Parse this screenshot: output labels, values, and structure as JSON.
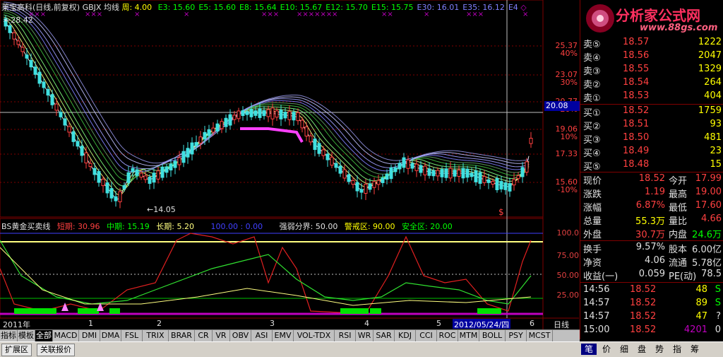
{
  "header": {
    "stock_name": "莱宝高科(日线,前复权)",
    "indicator": "GBJX 均线",
    "cycle": "周: 4.00",
    "ma": [
      {
        "label": "E3: 15.60",
        "color": "#00ff00"
      },
      {
        "label": "E5: 15.60",
        "color": "#00ff00"
      },
      {
        "label": "E8: 15.64",
        "color": "#00ff00"
      },
      {
        "label": "E10: 15.67",
        "color": "#00ff00"
      },
      {
        "label": "E12: 15.70",
        "color": "#00ff00"
      },
      {
        "label": "E15: 15.75",
        "color": "#00ff00"
      },
      {
        "label": "E30: 16.01",
        "color": "#8080ff"
      },
      {
        "label": "E35: 16.12",
        "color": "#8080ff"
      },
      {
        "label": "E4",
        "color": "#8080ff"
      }
    ],
    "marker": "◇"
  },
  "main_chart": {
    "y_ticks": [
      "25.37",
      "23.07",
      "20.77",
      "19.06",
      "17.33",
      "15.60"
    ],
    "y_pcts": [
      "40%",
      "30%",
      "20%",
      "10%",
      "",
      "-10%"
    ],
    "crosshair_value": "20.08",
    "high_label": "28.42",
    "low_label": "14.05",
    "signal_marks": [
      "×××",
      "×××",
      "×",
      "×",
      "×××",
      "×",
      "××××××",
      "××",
      "×",
      "×××",
      "×"
    ]
  },
  "indicator_panel": {
    "title": "BS黄金买卖线",
    "short_label": "短期: 30.96",
    "mid_label": "中期: 15.19",
    "long_label": "长期: 5.20",
    "extra_label": "100.00 : 0.00",
    "strength_label": "强弱分界: 50.00",
    "warn_label": "警戒区: 90.00",
    "safe_label": "安全区: 20.00",
    "y_ticks": [
      "100.0",
      "75.00",
      "50.00",
      "25.00"
    ]
  },
  "x_axis": {
    "labels": [
      "2011年",
      "1",
      "2",
      "3",
      "4",
      "5",
      "6"
    ],
    "cursor_date": "2012/05/24/四",
    "period": "日线"
  },
  "indicator_tabs": [
    "指标",
    "模板",
    "全部",
    "MACD",
    "DMI",
    "DMA",
    "FSL",
    "TRIX",
    "BRAR",
    "CR",
    "VR",
    "OBV",
    "ASI",
    "EMV",
    "VOL-TDX",
    "RSI",
    "WR",
    "SAR",
    "KDJ",
    "CCI",
    "ROC",
    "MTM",
    "BOLL",
    "PSY",
    "MCST"
  ],
  "bottom_tabs": [
    "扩展区",
    "关联报价"
  ],
  "right_tabs": [
    "笔",
    "价",
    "细",
    "盘",
    "势",
    "指",
    "筹",
    ""
  ],
  "logo": {
    "text": "分析家公式网",
    "url": "www.88gs.com"
  },
  "order_book": {
    "asks": [
      {
        "label": "卖⑤",
        "price": "18.57",
        "vol": "1222"
      },
      {
        "label": "卖④",
        "price": "18.56",
        "vol": "2047"
      },
      {
        "label": "卖③",
        "price": "18.55",
        "vol": "1329"
      },
      {
        "label": "卖②",
        "price": "18.54",
        "vol": "264"
      },
      {
        "label": "卖①",
        "price": "18.53",
        "vol": "404"
      }
    ],
    "bids": [
      {
        "label": "买①",
        "price": "18.52",
        "vol": "1759"
      },
      {
        "label": "买②",
        "price": "18.51",
        "vol": "93"
      },
      {
        "label": "买③",
        "price": "18.50",
        "vol": "481"
      },
      {
        "label": "买④",
        "price": "18.49",
        "vol": "23"
      },
      {
        "label": "买⑤",
        "price": "18.48",
        "vol": "15"
      }
    ]
  },
  "quote": [
    {
      "l1": "现价",
      "v1": "18.52",
      "c1": "#ff4040",
      "l2": "今开",
      "v2": "17.99",
      "c2": "#ff4040"
    },
    {
      "l1": "涨跌",
      "v1": "1.19",
      "c1": "#ff4040",
      "l2": "最高",
      "v2": "19.00",
      "c2": "#ff4040"
    },
    {
      "l1": "涨幅",
      "v1": "6.87%",
      "c1": "#ff4040",
      "l2": "最低",
      "v2": "17.60",
      "c2": "#ff4040"
    },
    {
      "l1": "总量",
      "v1": "55.3万",
      "c1": "#ffff00",
      "l2": "量比",
      "v2": "4.66",
      "c2": "#ff4040"
    },
    {
      "l1": "外盘",
      "v1": "30.7万",
      "c1": "#ff4040",
      "l2": "内盘",
      "v2": "24.6万",
      "c2": "#00ff00"
    }
  ],
  "quote2": [
    {
      "l1": "换手",
      "v1": "9.57%",
      "c1": "#e0e0e0",
      "l2": "股本",
      "v2": "6.00亿",
      "c2": "#e0e0e0"
    },
    {
      "l1": "净资",
      "v1": "4.06",
      "c1": "#e0e0e0",
      "l2": "流通",
      "v2": "5.78亿",
      "c2": "#e0e0e0"
    },
    {
      "l1": "收益(一)",
      "v1": "0.059",
      "c1": "#e0e0e0",
      "l2": "PE(动)",
      "v2": "78.5",
      "c2": "#e0e0e0"
    }
  ],
  "ticks": [
    {
      "time": "14:56",
      "price": "18.52",
      "vol": "48",
      "vc": "#ffff00",
      "dir": "S",
      "dc": "#00ff00"
    },
    {
      "time": "14:57",
      "price": "18.52",
      "vol": "89",
      "vc": "#ffff00",
      "dir": "S",
      "dc": "#00ff00"
    },
    {
      "time": "14:57",
      "price": "18.52",
      "vol": "47",
      "vc": "#ffff00",
      "dir": "?",
      "dc": "#e0e0e0"
    },
    {
      "time": "15:00",
      "price": "18.52",
      "vol": "4201",
      "vc": "#c000c0",
      "dir": "0",
      "dc": "#e0e0e0"
    }
  ]
}
